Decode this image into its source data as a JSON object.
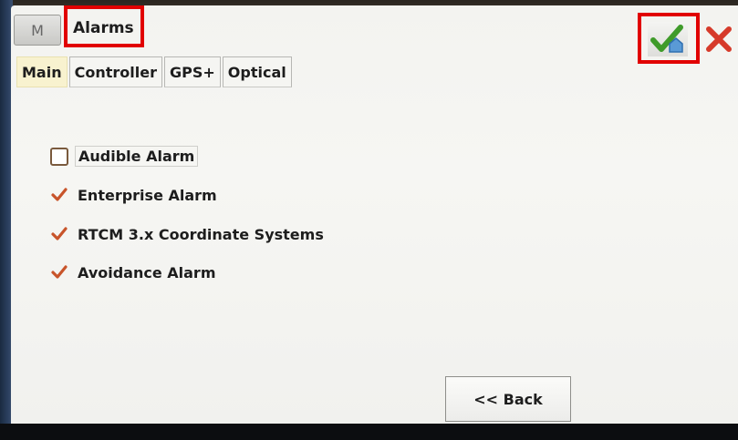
{
  "header": {
    "menu_icon": "M",
    "title": "Alarms",
    "ok_icon": "check-home-icon",
    "cancel_icon": "close-icon"
  },
  "tabs": [
    {
      "label": "Main",
      "active": true
    },
    {
      "label": "Controller",
      "active": false
    },
    {
      "label": "GPS+",
      "active": false
    },
    {
      "label": "Optical",
      "active": false
    }
  ],
  "alarms": [
    {
      "label": "Audible Alarm",
      "checked": false
    },
    {
      "label": "Enterprise Alarm",
      "checked": true
    },
    {
      "label": "RTCM 3.x Coordinate Systems",
      "checked": true
    },
    {
      "label": "Avoidance Alarm",
      "checked": true
    }
  ],
  "footer": {
    "back_label": "<< Back"
  },
  "colors": {
    "highlight": "#e10000",
    "check": "#c8542a",
    "ok_green": "#3f9b2a",
    "cancel_red": "#d63a2a",
    "active_tab": "#f8f2cf"
  }
}
